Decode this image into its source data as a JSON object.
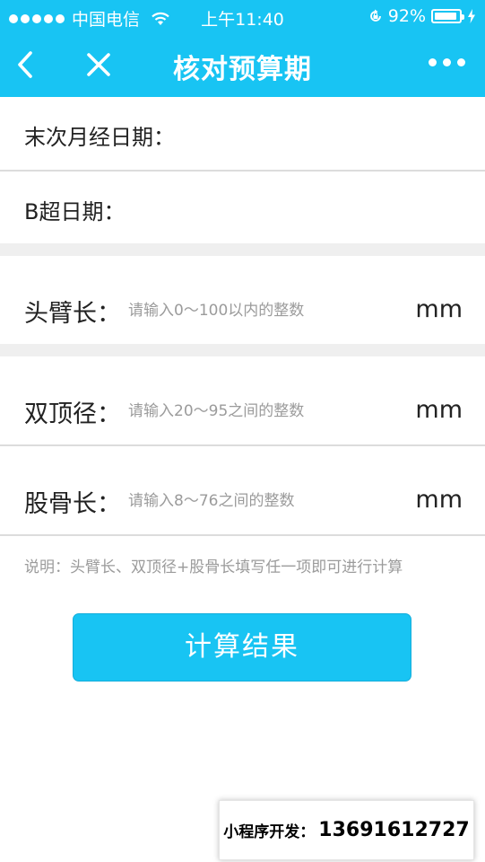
{
  "status_bar": {
    "carrier": "中国电信",
    "time": "上午11:40",
    "battery": "92%",
    "battery_level": 0.92
  },
  "nav": {
    "title": "核对预算期",
    "back_icon": "back-chevron-icon",
    "close_icon": "close-icon",
    "more_icon": "more-dots-icon"
  },
  "form": {
    "lmp_label": "末次月经日期：",
    "bscan_label": "B超日期：",
    "crl": {
      "label": "头臂长：",
      "placeholder": "请输入0～100以内的整数",
      "unit": "mm"
    },
    "bpd": {
      "label": "双顶径：",
      "placeholder": "请输入20～95之间的整数",
      "unit": "mm"
    },
    "fl": {
      "label": "股骨长：",
      "placeholder": "请输入8～76之间的整数",
      "unit": "mm"
    },
    "note": "说明：头臂长、双顶径+股骨长填写任一项即可进行计算"
  },
  "actions": {
    "calculate_label": "计算结果"
  },
  "promo": {
    "label": "小程序开发：",
    "phone": "13691612727"
  },
  "colors": {
    "accent": "#18c4f3",
    "divider": "#dcdcdc",
    "section_gap": "#efefef",
    "placeholder": "#9b9b9b"
  }
}
